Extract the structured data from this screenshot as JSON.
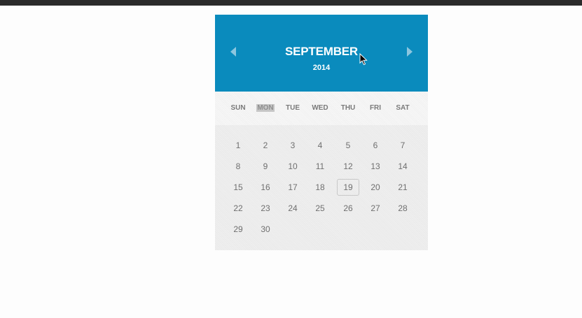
{
  "calendar": {
    "month": "SEPTEMBER",
    "year": "2014",
    "weekdays": [
      "SUN",
      "MON",
      "TUE",
      "WED",
      "THU",
      "FRI",
      "SAT"
    ],
    "highlighted_weekday": "MON",
    "today": "19",
    "weeks": [
      [
        "",
        "1",
        "2",
        "3",
        "4",
        "5",
        "6",
        "7"
      ],
      [
        "",
        "8",
        "9",
        "10",
        "11",
        "12",
        "13",
        "14"
      ],
      [
        "",
        "15",
        "16",
        "17",
        "18",
        "19",
        "20",
        "21"
      ],
      [
        "",
        "22",
        "23",
        "24",
        "25",
        "26",
        "27",
        "28"
      ],
      [
        "",
        "29",
        "30"
      ]
    ]
  },
  "icons": {
    "prev": "triangle-left-icon",
    "next": "triangle-right-icon",
    "cursor": "mouse-pointer-icon"
  },
  "colors": {
    "header_bg": "#0a8bbd",
    "arrow": "#8cc6df",
    "header_text": "#ffffff",
    "day_text": "#6f6f6f",
    "weekday_highlight": "#c6c6c6"
  }
}
